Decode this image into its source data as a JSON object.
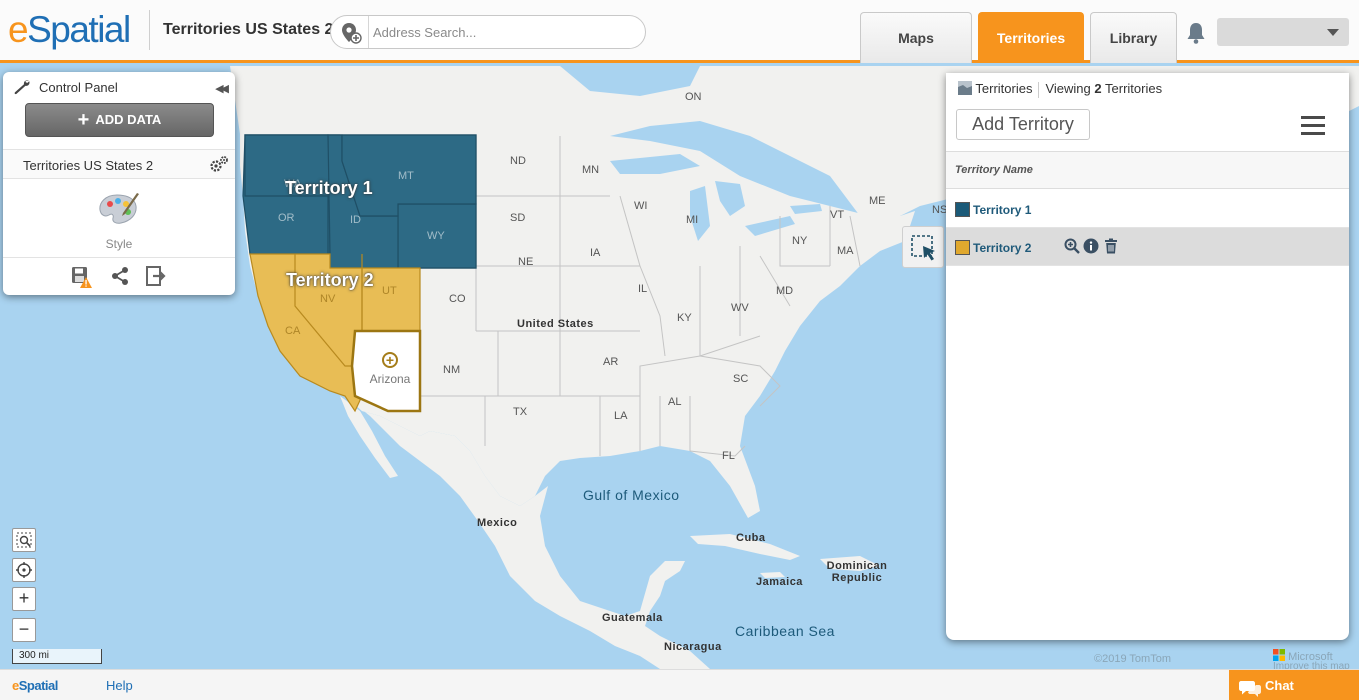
{
  "header": {
    "logo_e": "e",
    "logo_rest": "Spatial",
    "map_title": "Territories US States 2",
    "search_placeholder": "Address Search...",
    "tabs": [
      {
        "label": "Maps",
        "active": false
      },
      {
        "label": "Territories",
        "active": true
      },
      {
        "label": "Library",
        "active": false
      }
    ],
    "accent_color": "#f7941d",
    "brand_color": "#1f6fb5"
  },
  "control_panel": {
    "title": "Control Panel",
    "add_data_label": "ADD DATA",
    "layer_name": "Territories US States 2",
    "style_label": "Style"
  },
  "map": {
    "territory_labels": [
      "Territory 1",
      "Territory 2"
    ],
    "highlight_state": "Arizona",
    "territory_states": {
      "territory_1": [
        "WA",
        "OR",
        "ID",
        "MT",
        "WY"
      ],
      "territory_2": [
        "CA",
        "NV",
        "UT"
      ]
    },
    "state_labels": [
      "ND",
      "SD",
      "NE",
      "MN",
      "IA",
      "WI",
      "IL",
      "MI",
      "CO",
      "NM",
      "TX",
      "AR",
      "LA",
      "AL",
      "KY",
      "WV",
      "MD",
      "NY",
      "VT",
      "ME",
      "MA",
      "SC",
      "FL",
      "ON",
      "NS"
    ],
    "country_labels": [
      "United States",
      "Mexico",
      "Cuba",
      "Jamaica",
      "Dominican Republic",
      "Guatemala",
      "Nicaragua"
    ],
    "water_labels": [
      "Gulf of Mexico",
      "Caribbean Sea"
    ],
    "scale": "300 mi",
    "copyright": "©2019 TomTom",
    "microsoft": "Microsoft",
    "improve": "Improve this map",
    "colors": {
      "territory_1": "#2d6a85",
      "territory_2": "#e8bd55",
      "water": "#a9d3f0",
      "land": "#f1f1ef"
    }
  },
  "territories_panel": {
    "tab_label": "Territories",
    "viewing_prefix": "Viewing",
    "viewing_count": "2",
    "viewing_suffix": "Territories",
    "add_button": "Add Territory",
    "column_header": "Territory Name",
    "rows": [
      {
        "name": "Territory 1",
        "color": "#1b5a78",
        "selected": false
      },
      {
        "name": "Territory 2",
        "color": "#e0a82e",
        "selected": true
      }
    ]
  },
  "footer": {
    "logo_e": "e",
    "logo_rest": "Spatial",
    "help": "Help",
    "chat": "Chat"
  }
}
